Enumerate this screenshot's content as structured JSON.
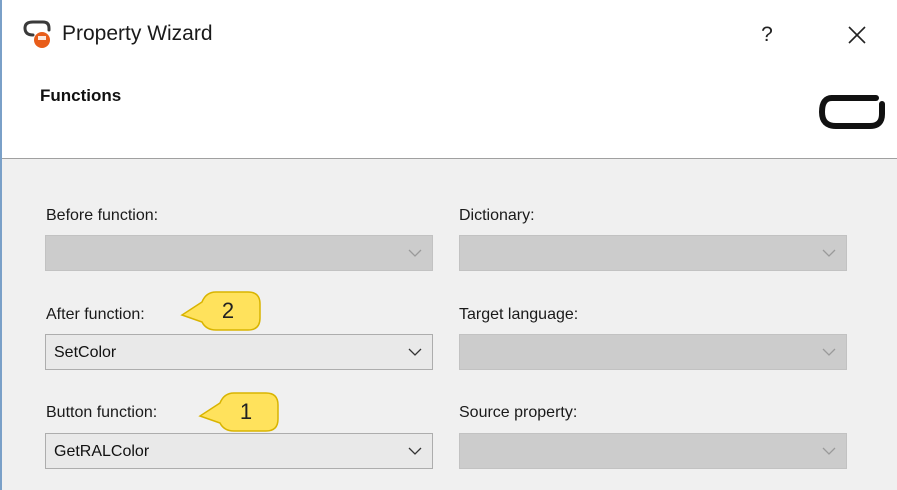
{
  "window": {
    "title": "Property Wizard",
    "help_label": "?",
    "close_label": "×"
  },
  "header": {
    "title": "Functions",
    "logo_icon": "brand-logo-icon"
  },
  "form": {
    "before_function": {
      "label": "Before function:",
      "value": "",
      "enabled": false
    },
    "after_function": {
      "label": "After function:",
      "value": "SetColor",
      "enabled": true
    },
    "button_function": {
      "label": "Button function:",
      "value": "GetRALColor",
      "enabled": true
    },
    "dictionary": {
      "label": "Dictionary:",
      "value": "",
      "enabled": false
    },
    "target_language": {
      "label": "Target language:",
      "value": "",
      "enabled": false
    },
    "source_property": {
      "label": "Source property:",
      "value": "",
      "enabled": false
    }
  },
  "callouts": [
    {
      "label": "2",
      "color": "#ffe25c"
    },
    {
      "label": "1",
      "color": "#ffe25c"
    }
  ],
  "colors": {
    "callout_fill": "#ffe25c",
    "callout_border": "#d9b400",
    "app_icon_accent": "#e85d1a"
  }
}
